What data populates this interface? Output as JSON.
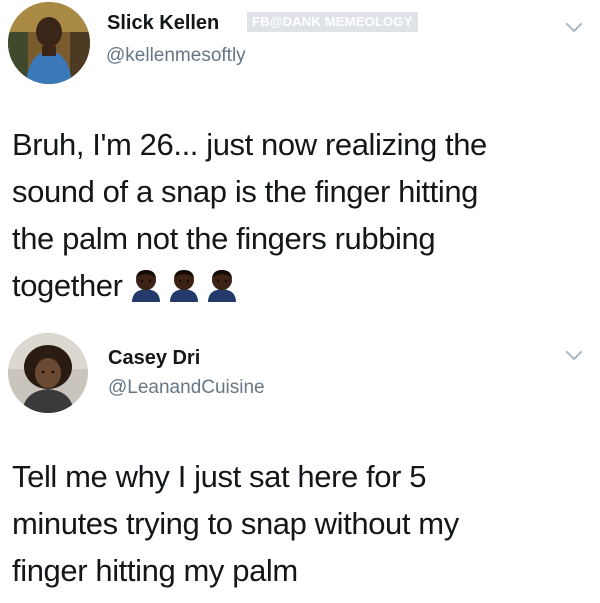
{
  "watermark": "FB@DANK MEMEOLOGY",
  "tweets": [
    {
      "display_name": "Slick Kellen",
      "handle": "@kellenmesoftly",
      "body_lines": [
        "Bruh, I'm 26... just now realizing the",
        "sound of a snap is the finger hitting",
        "the palm not the fingers rubbing",
        "together"
      ],
      "emojis": [
        "dark-skin-tone-man-icon",
        "dark-skin-tone-man-icon",
        "dark-skin-tone-man-icon"
      ]
    },
    {
      "display_name": "Casey Dri",
      "handle": "@LeanandCuisine",
      "body_lines": [
        "Tell me why I just sat here for 5",
        "minutes trying to snap without my",
        "finger hitting my palm"
      ]
    }
  ],
  "colors": {
    "name": "#14171a",
    "handle": "#657786",
    "chevron": "#aab8c2"
  }
}
